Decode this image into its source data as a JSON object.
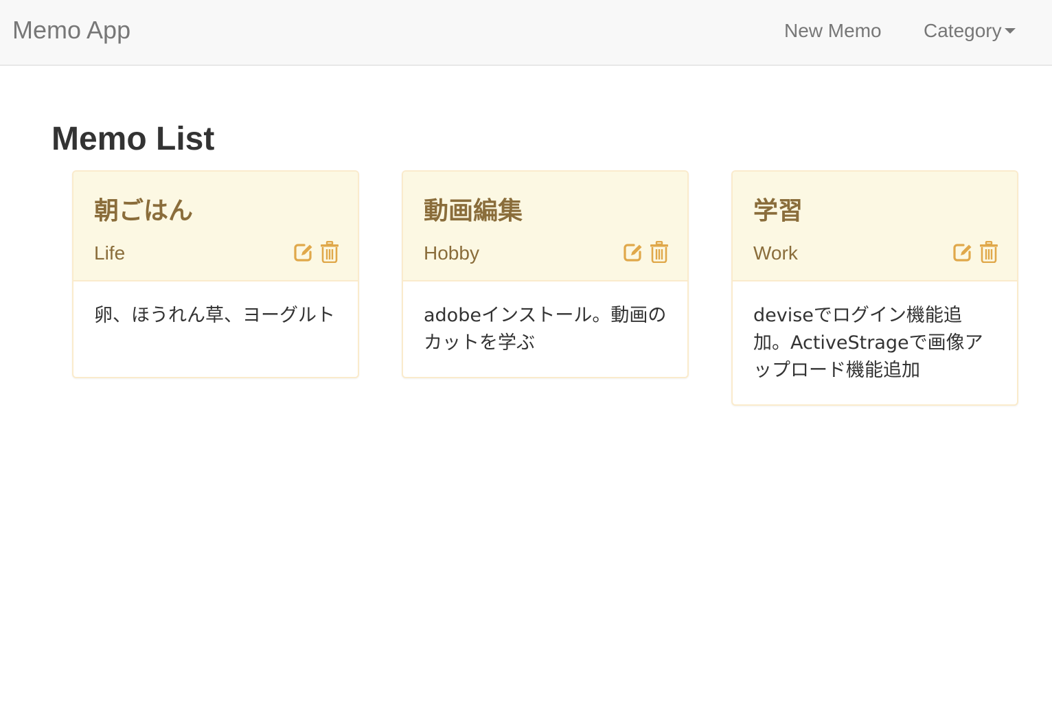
{
  "navbar": {
    "brand": "Memo App",
    "new_memo": "New Memo",
    "category": "Category"
  },
  "main": {
    "title": "Memo List",
    "memos": [
      {
        "title": "朝ごはん",
        "category": "Life",
        "body": "卵、ほうれん草、ヨーグルト"
      },
      {
        "title": "動画編集",
        "category": "Hobby",
        "body": "adobeインストール。動画のカットを学ぶ"
      },
      {
        "title": "学習",
        "category": "Work",
        "body": "deviseでログイン機能追加。ActiveStrageで画像アップロード機能追加"
      }
    ]
  },
  "icons": {
    "edit": "edit-icon",
    "trash": "trash-icon"
  },
  "colors": {
    "panel_heading_bg": "#fcf8e3",
    "panel_border": "#faebcc",
    "panel_text": "#8a6d3b",
    "icon_color": "#e0a84a",
    "navbar_bg": "#f8f8f8",
    "navbar_text": "#777777"
  }
}
